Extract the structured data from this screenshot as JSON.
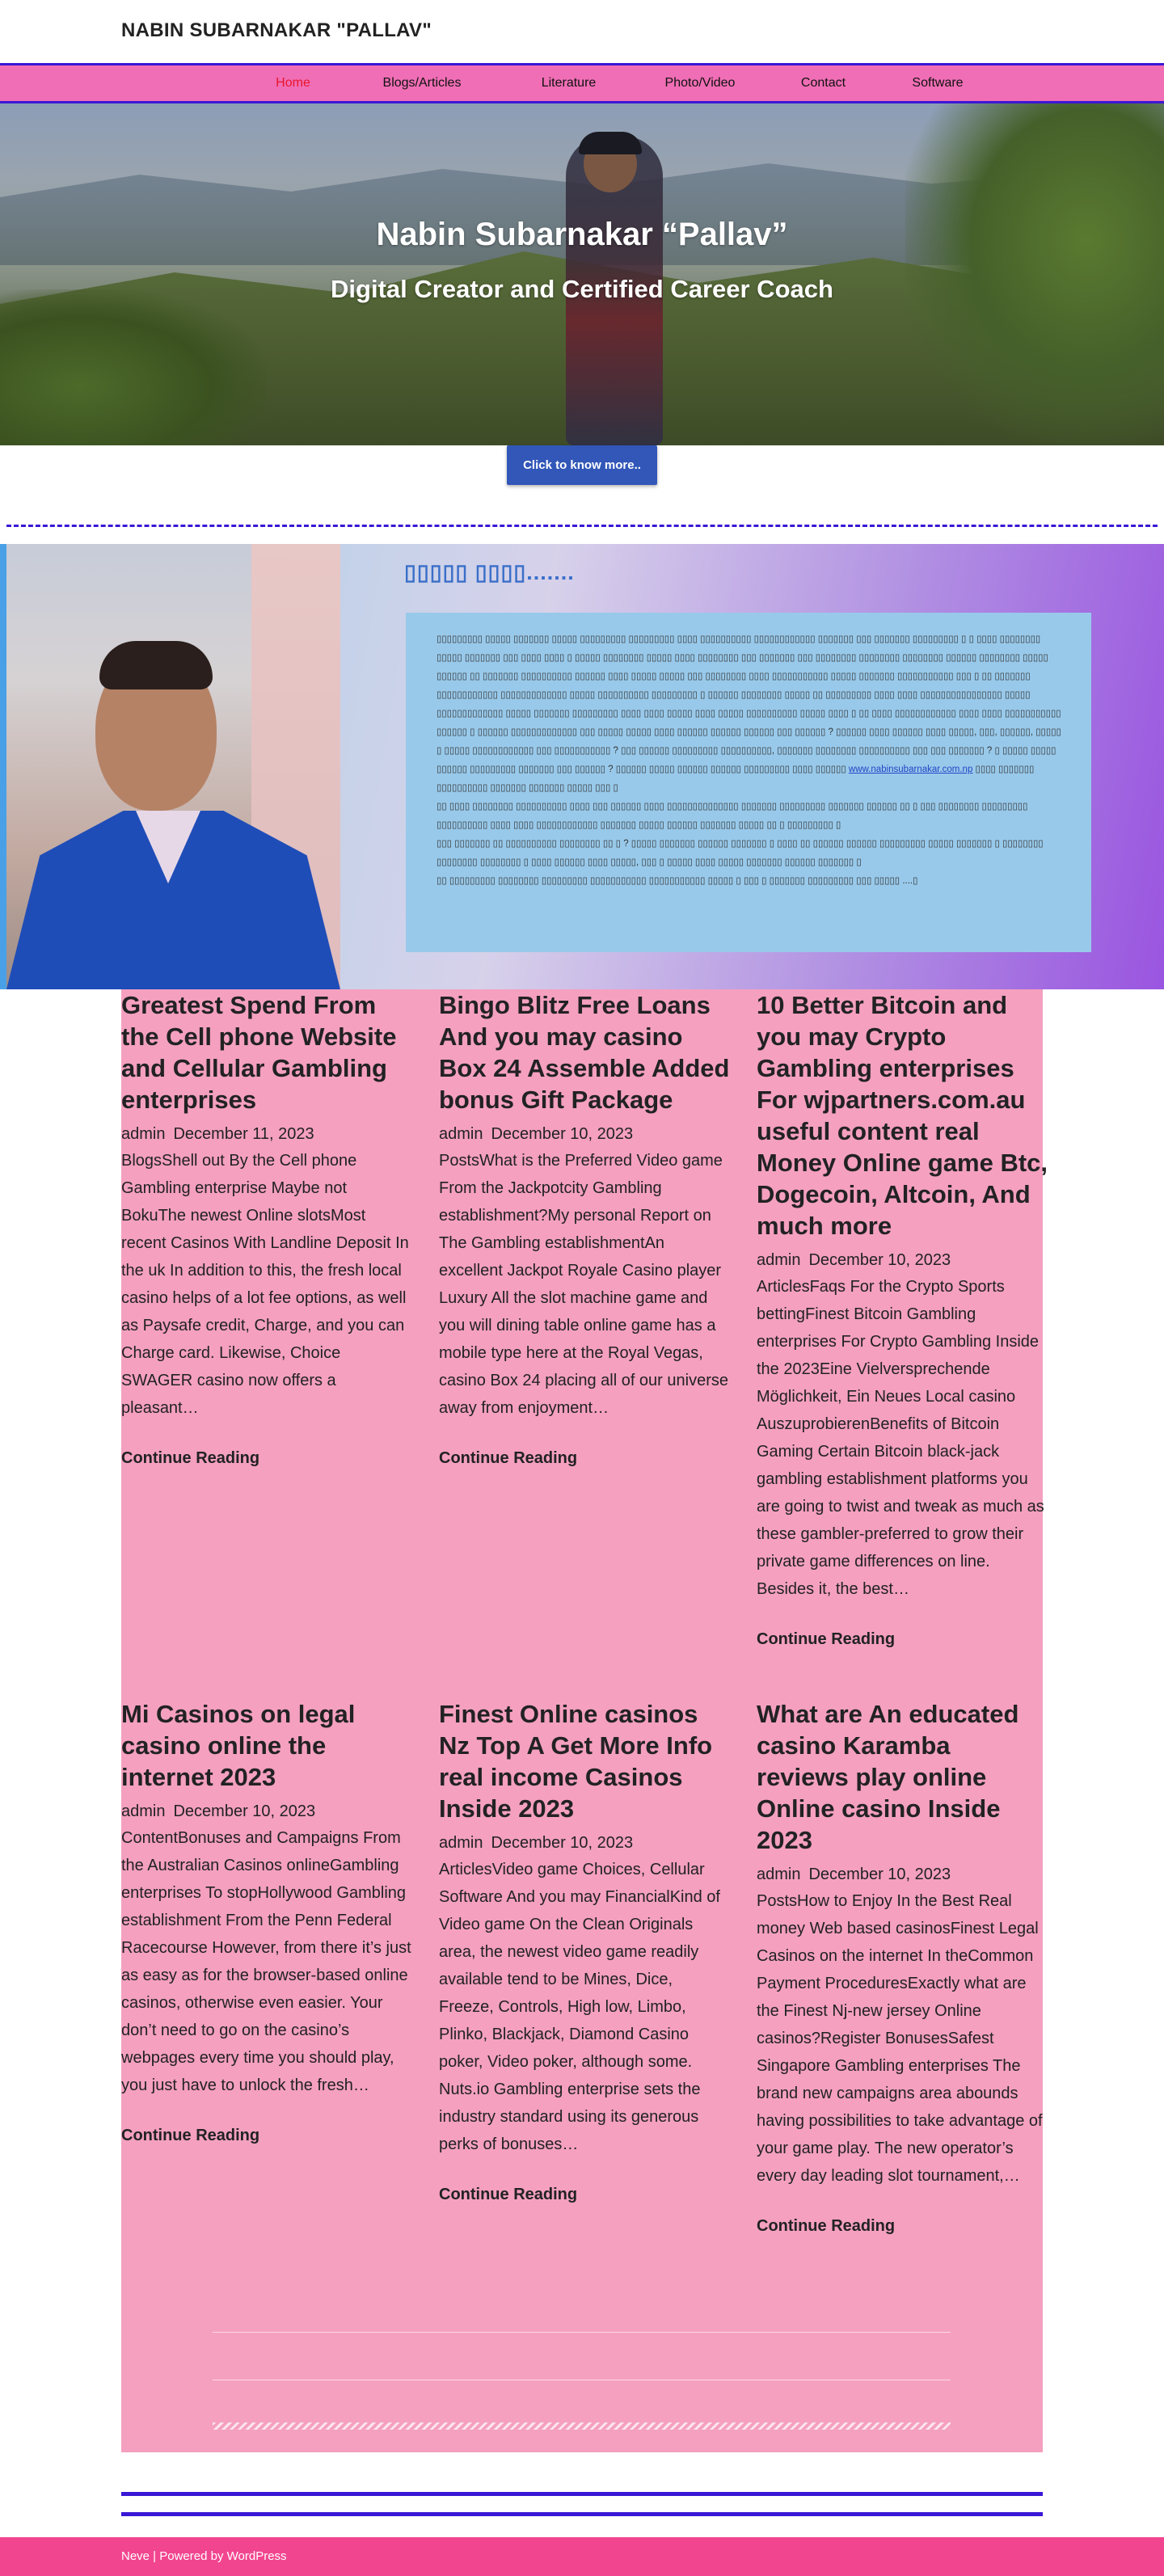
{
  "site": {
    "title": "NABIN SUBARNAKAR \"PALLAV\""
  },
  "nav": {
    "items": [
      "Home",
      "Blogs/Articles",
      "Literature",
      "Photo/Video",
      "Contact",
      "Software"
    ],
    "active_color": "#e8162e"
  },
  "hero": {
    "title": "Nabin Subarnakar “Pallav”",
    "subtitle": "Digital Creator and Certified Career Coach",
    "cta_label": "Click to know more.."
  },
  "about": {
    "heading": "▯▯▯▯▯ ▯▯▯▯.......",
    "paragraph1_a": "▯▯▯▯▯▯▯▯▯ ▯▯▯▯▯ ▯▯▯▯▯▯▯ ▯▯▯▯▯ ▯▯▯▯▯▯▯▯▯ ▯▯▯▯▯▯▯▯▯ ▯▯▯▯ ▯▯▯▯▯▯▯▯▯▯ ▯▯▯▯▯▯▯▯▯▯▯▯ ▯▯▯▯▯▯▯ ▯▯▯ ▯▯▯▯▯▯▯ ▯▯▯▯▯▯▯▯▯ ▯ ▯ ▯▯▯▯ ▯▯▯▯▯▯▯▯ ▯▯▯▯▯ ▯▯▯▯▯▯▯ ▯▯▯ ▯▯▯▯ ▯▯▯▯ ▯ ▯▯▯▯▯ ▯▯▯▯▯▯▯▯ ▯▯▯▯▯ ▯▯▯▯ ▯▯▯▯▯▯▯▯ ▯▯▯ ▯▯▯▯▯▯▯ ▯▯▯ ▯▯▯▯▯▯▯▯ ▯▯▯▯▯▯▯▯ ▯▯▯▯▯▯▯▯ ▯▯▯▯▯▯ ▯▯▯▯▯▯▯▯ ▯▯▯▯▯ ▯▯▯▯▯▯ ▯▯ ▯▯▯▯▯▯▯ ▯▯▯▯▯▯▯▯▯▯ ▯▯▯▯▯▯ ▯▯▯▯ ▯▯▯▯▯ ▯▯▯▯▯ ▯▯▯ ▯▯▯▯▯▯▯▯ ▯▯▯▯ ▯▯▯▯▯▯▯▯▯▯▯ ▯▯▯▯▯ ▯▯▯▯▯▯▯ ▯▯▯▯▯▯▯▯▯▯▯ ▯▯▯ ▯ ▯▯ ▯▯▯▯▯▯▯ ▯▯▯▯▯▯▯▯▯▯▯▯ ▯▯▯▯▯▯▯▯▯▯▯▯▯ ▯▯▯▯▯ ▯▯▯▯▯▯▯▯▯▯ ▯▯▯▯▯▯▯▯▯ ▯ ▯▯▯▯▯▯ ▯▯▯▯▯▯▯▯ ▯▯▯▯▯ ▯▯ ▯▯▯▯▯▯▯▯▯ ▯▯▯▯ ▯▯▯▯ ▯▯▯▯▯▯▯▯▯▯▯▯▯▯▯▯ ▯▯▯▯▯ ▯▯▯▯▯▯▯▯▯▯▯▯▯ ▯▯▯▯▯ ▯▯▯▯▯▯▯ ▯▯▯▯▯▯▯▯▯ ▯▯▯▯ ▯▯▯▯ ▯▯▯▯▯ ▯▯▯▯ ▯▯▯▯▯ ▯▯▯▯▯▯▯▯▯▯ ▯▯▯▯▯ ▯▯▯▯ ▯ ▯▯ ▯▯▯▯ ▯▯▯▯▯▯▯▯▯▯▯▯ ▯▯▯▯ ▯▯▯▯ ▯▯▯▯▯▯▯▯▯▯▯ ▯▯▯▯▯▯ ▯ ▯▯▯▯▯▯ ▯▯▯▯▯▯▯▯▯▯▯▯▯ ▯▯▯ ▯▯▯▯▯ ▯▯▯▯▯ ▯▯▯▯ ▯▯▯▯▯▯ ▯▯▯▯▯▯ ▯▯▯▯▯▯ ▯▯▯ ▯▯▯▯▯▯ ? ▯▯▯▯▯▯ ▯▯▯▯ ▯▯▯▯▯▯ ▯▯▯▯ ▯▯▯▯▯, ▯▯▯, ▯▯▯▯▯▯, ▯▯▯▯▯ ▯ ▯▯▯▯▯ ▯▯▯▯▯▯▯▯▯▯▯▯ ▯▯▯ ▯▯▯▯▯▯▯▯▯▯▯ ? ▯▯▯ ▯▯▯▯▯▯ ▯▯▯▯▯▯▯▯▯ ▯▯▯▯▯▯▯▯▯▯, ▯▯▯▯▯▯▯ ▯▯▯▯▯▯▯▯ ▯▯▯▯▯▯▯▯▯▯ ▯▯▯ ▯▯▯ ▯▯▯▯▯▯▯ ? ▯ ▯▯▯▯▯ ▯▯▯▯▯ ▯▯▯▯▯▯ ▯▯▯▯▯▯▯▯▯ ▯▯▯▯▯▯▯ ▯▯▯ ▯▯▯▯▯▯ ? ▯▯▯▯▯▯ ▯▯▯▯▯ ▯▯▯▯▯▯ ▯▯▯▯▯▯ ▯▯▯▯▯▯▯▯▯ ▯▯▯▯ ▯▯▯▯▯▯",
    "link_text": "www.nabinsubarnakar.com.np",
    "paragraph1_b": "▯▯▯▯ ▯▯▯▯▯▯▯ ▯▯▯▯▯▯▯▯▯▯ ▯▯▯▯▯▯▯ ▯▯▯▯▯▯▯ ▯▯▯▯▯ ▯▯▯ ▯",
    "paragraph2": "▯▯ ▯▯▯▯ ▯▯▯▯▯▯▯▯ ▯▯▯▯▯▯▯▯▯▯ ▯▯▯▯ ▯▯▯ ▯▯▯▯▯▯ ▯▯▯▯ ▯▯▯▯▯▯▯▯▯▯▯▯▯▯ ▯▯▯▯▯▯▯ ▯▯▯▯▯▯▯▯▯ ▯▯▯▯▯▯▯ ▯▯▯▯▯▯ ▯▯ ▯ ▯▯▯ ▯▯▯▯▯▯▯▯ ▯▯▯▯▯▯▯▯▯ ▯▯▯▯▯▯▯▯▯▯ ▯▯▯▯ ▯▯▯▯ ▯▯▯▯▯▯▯▯▯▯▯▯ ▯▯▯▯▯▯▯ ▯▯▯▯▯ ▯▯▯▯▯▯ ▯▯▯▯▯▯▯ ▯▯▯▯▯ ▯▯ ▯ ▯▯▯▯▯▯▯▯▯ ▯",
    "paragraph3": "▯▯▯ ▯▯▯▯▯▯▯ ▯▯ ▯▯▯▯▯▯▯▯▯▯ ▯▯▯▯▯▯▯▯ ▯▯ ▯ ? ▯▯▯▯▯ ▯▯▯▯▯▯▯ ▯▯▯▯▯▯ ▯▯▯▯▯▯▯ ▯ ▯▯▯▯ ▯▯ ▯▯▯▯▯▯ ▯▯▯▯▯▯ ▯▯▯▯▯▯▯▯▯ ▯▯▯▯▯ ▯▯▯▯▯▯▯ ▯ ▯▯▯▯▯▯▯▯ ▯▯▯▯▯▯▯▯ ▯▯▯▯▯▯▯▯ ▯ ▯▯▯▯ ▯▯▯▯▯▯ ▯▯▯▯ ▯▯▯▯▯, ▯▯▯ ▯ ▯▯▯▯▯ ▯▯▯▯ ▯▯▯▯▯ ▯▯▯▯▯▯▯ ▯▯▯▯▯▯ ▯▯▯▯▯▯▯ ▯",
    "paragraph4": "▯▯ ▯▯▯▯▯▯▯▯▯ ▯▯▯▯▯▯▯▯ ▯▯▯▯▯▯▯▯▯ ▯▯▯▯▯▯▯▯▯▯▯ ▯▯▯▯▯▯▯▯▯▯▯ ▯▯▯▯▯ ▯ ▯▯▯ ▯ ▯▯▯▯▯▯▯ ▯▯▯▯▯▯▯▯▯ ▯▯▯ ▯▯▯▯▯ ....▯"
  },
  "posts": [
    {
      "title": "Greatest Spend From the Cell phone Website and Cellular Gambling enterprises",
      "author": "admin",
      "date": "December 11, 2023",
      "excerpt": "BlogsShell out By the Cell phone Gambling enterprise Maybe not BokuThe newest Online slotsMost recent Casinos With Landline Deposit In the uk In addition to this, the fresh local casino helps of a lot fee options, as well as Paysafe credit, Charge, and you can Charge card. Likewise, Choice SWAGER casino now offers a pleasant…",
      "more": "Continue Reading"
    },
    {
      "title": "Bingo Blitz Free Loans And you may casino Box 24 Assemble Added bonus Gift Package",
      "author": "admin",
      "date": "December 10, 2023",
      "excerpt": "PostsWhat is the Preferred Video game From the Jackpotcity Gambling establishment?My personal Report on The Gambling establishmentAn excellent Jackpot Royale Casino player Luxury All the slot machine game and you will dining table online game has a mobile type here at the Royal Vegas, casino Box 24 placing all of our universe away from enjoyment…",
      "more": "Continue Reading"
    },
    {
      "title": "10 Better Bitcoin and you may Crypto Gambling enterprises For wjpartners.com.au useful content real Money Online game Btc, Dogecoin, Altcoin, And much more",
      "author": "admin",
      "date": "December 10, 2023",
      "excerpt": "ArticlesFaqs For the Crypto Sports bettingFinest Bitcoin Gambling enterprises For Crypto Gambling Inside the 2023Eine Vielversprechende Möglichkeit, Ein Neues Local casino AuszuprobierenBenefits of Bitcoin Gaming Certain Bitcoin black-jack gambling establishment platforms you are going to twist and tweak as much as these gambler-preferred to grow their private game differences on line. Besides it, the best…",
      "more": "Continue Reading"
    },
    {
      "title": "Mi Casinos on legal casino online the internet 2023",
      "author": "admin",
      "date": "December 10, 2023",
      "excerpt": "ContentBonuses and Campaigns From the Australian Casinos onlineGambling enterprises To stopHollywood Gambling establishment From the Penn Federal Racecourse However, from there it’s just as easy as for the browser-based online casinos, otherwise even easier. Your don’t need to go on the casino’s webpages every time you should play, you just have to unlock the fresh…",
      "more": "Continue Reading"
    },
    {
      "title": "Finest Online casinos Nz Top A Get More Info real income Casinos Inside 2023",
      "author": "admin",
      "date": "December 10, 2023",
      "excerpt": "ArticlesVideo game Choices, Cellular Software And you may FinancialKind of Video game On the Clean Originals area, the newest video game readily available tend to be Mines, Dice, Freeze, Controls, High low, Limbo, Plinko, Blackjack, Diamond Casino poker, Video poker, although some. Nuts.io Gambling enterprise sets the industry standard using its generous perks of bonuses…",
      "more": "Continue Reading"
    },
    {
      "title": "What are An educated casino Karamba reviews play online Online casino Inside 2023",
      "author": "admin",
      "date": "December 10, 2023",
      "excerpt": "PostsHow to Enjoy In the Best Real money Web based casinosFinest Legal Casinos on the internet In theCommon Payment ProceduresExactly what are the Finest Nj-new jersey Online casinos?Register BonusesSafest Singapore Gambling enterprises The brand new campaigns area abounds having possibilities to take advantage of your game play. The new operator’s every day leading slot tournament,…",
      "more": "Continue Reading"
    }
  ],
  "footer": {
    "credit": "Neve | Powered by WordPress"
  },
  "colors": {
    "nav_bg": "#f06eb5",
    "nav_border": "#3a17d6",
    "posts_bg": "#f5a0bf",
    "footer_bg": "#f2458f",
    "cta_bg": "#3257b8",
    "about_box_bg": "#98c9ea"
  }
}
